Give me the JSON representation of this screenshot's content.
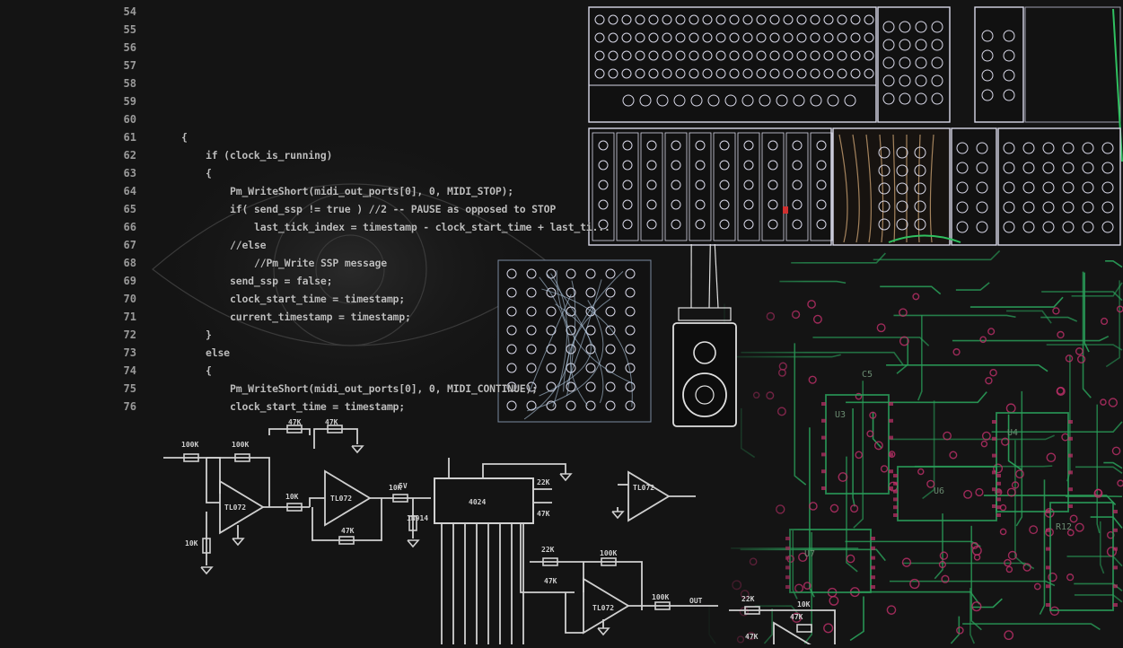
{
  "editor": {
    "lines": [
      {
        "num": "54",
        "indent": 0,
        "text": ""
      },
      {
        "num": "55",
        "indent": 0,
        "text": ""
      },
      {
        "num": "56",
        "indent": 0,
        "text": ""
      },
      {
        "num": "57",
        "indent": 0,
        "text": ""
      },
      {
        "num": "58",
        "indent": 0,
        "text": ""
      },
      {
        "num": "59",
        "indent": 0,
        "text": ""
      },
      {
        "num": "60",
        "indent": 0,
        "text": ""
      },
      {
        "num": "61",
        "indent": 0,
        "text": "{"
      },
      {
        "num": "62",
        "indent": 1,
        "text": "if (clock_is_running)"
      },
      {
        "num": "63",
        "indent": 1,
        "text": "{"
      },
      {
        "num": "64",
        "indent": 2,
        "text": "Pm_WriteShort(midi_out_ports[0], 0, MIDI_STOP);"
      },
      {
        "num": "65",
        "indent": 2,
        "text": "if( send_ssp != true ) //2 -- PAUSE as opposed to STOP"
      },
      {
        "num": "66",
        "indent": 3,
        "text": "last_tick_index = timestamp - clock_start_time + last_ti..."
      },
      {
        "num": "67",
        "indent": 2,
        "text": "//else"
      },
      {
        "num": "68",
        "indent": 3,
        "text": "//Pm_Write SSP message"
      },
      {
        "num": "69",
        "indent": 2,
        "text": "send_ssp = false;"
      },
      {
        "num": "70",
        "indent": 2,
        "text": "clock_start_time = timestamp;"
      },
      {
        "num": "71",
        "indent": 2,
        "text": "current_timestamp = timestamp;"
      },
      {
        "num": "72",
        "indent": 1,
        "text": "}"
      },
      {
        "num": "73",
        "indent": 1,
        "text": "else"
      },
      {
        "num": "74",
        "indent": 1,
        "text": "{"
      },
      {
        "num": "75",
        "indent": 2,
        "text": "Pm_WriteShort(midi_out_ports[0], 0, MIDI_CONTINUE);"
      },
      {
        "num": "76",
        "indent": 2,
        "text": "clock_start_time = timestamp;"
      }
    ]
  },
  "schematic": {
    "labels": [
      "47K",
      "47K",
      "100K",
      "100K",
      "TL072",
      "TL072",
      "10K",
      "10K",
      "47K",
      "10K",
      "1N914",
      "22K",
      "4024",
      "100K",
      "47K",
      "TL072",
      "22K",
      "47K",
      "100K",
      "TL072",
      "OUT",
      "47K",
      "22K",
      "10K",
      "5V",
      "47K"
    ]
  },
  "pcb": {
    "labels": [
      "U3",
      "U4",
      "U6",
      "U7",
      "R12",
      "C5"
    ]
  },
  "colors": {
    "background": "#141414",
    "code_text": "#bdbdbd",
    "line_number": "#9a9a9a",
    "schematic": "#d0d0d0",
    "pcb_trace": "#2aa05a",
    "pcb_pad": "#c0306a",
    "panel_edge": "#d8d8e8"
  }
}
